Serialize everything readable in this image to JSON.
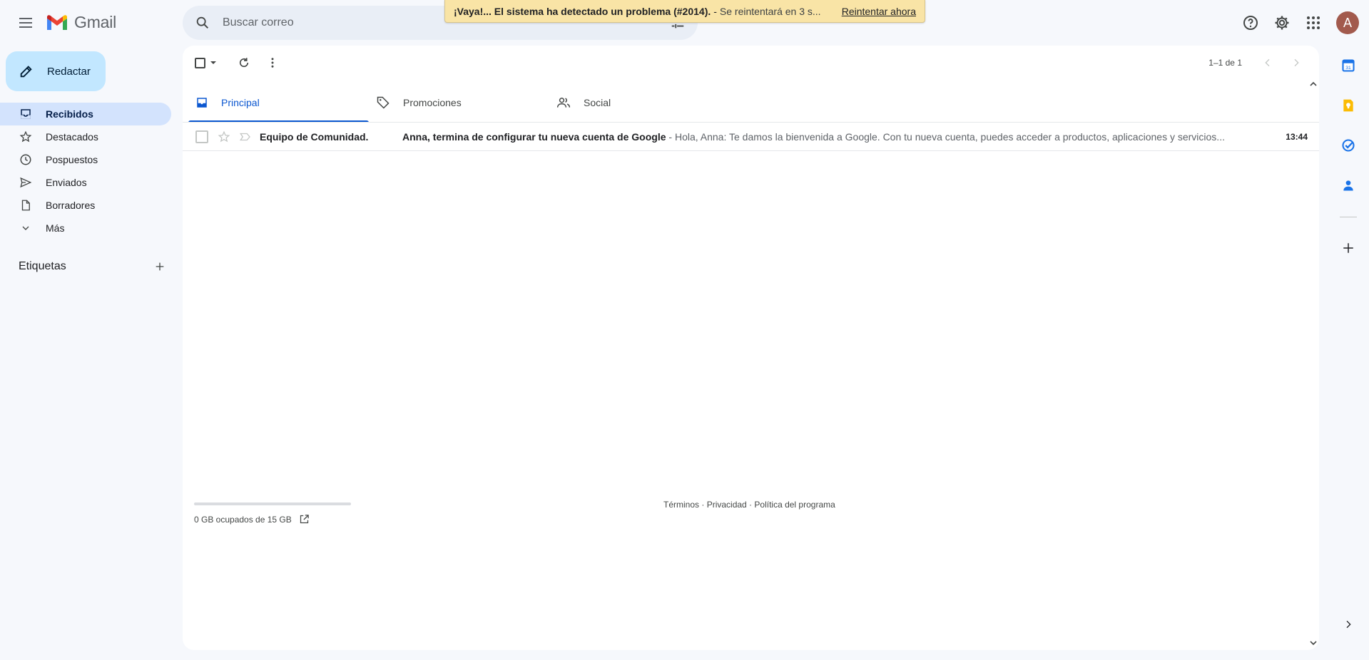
{
  "topbar": {
    "logo_text": "Gmail",
    "search_placeholder": "Buscar correo",
    "avatar_letter": "A"
  },
  "toast": {
    "title": "¡Vaya!... El sistema ha detectado un problema (#2014).",
    "separator": "-",
    "message": "Se reintentará en 3 s...",
    "action": "Reintentar ahora"
  },
  "compose": {
    "label": "Redactar"
  },
  "nav": {
    "items": [
      {
        "label": "Recibidos",
        "icon": "inbox-icon"
      },
      {
        "label": "Destacados",
        "icon": "star-icon"
      },
      {
        "label": "Pospuestos",
        "icon": "clock-icon"
      },
      {
        "label": "Enviados",
        "icon": "send-icon"
      },
      {
        "label": "Borradores",
        "icon": "draft-icon"
      },
      {
        "label": "Más",
        "icon": "chevron-down-icon"
      }
    ],
    "labels_title": "Etiquetas"
  },
  "toolbar": {
    "pager": "1–1 de 1"
  },
  "tabs": [
    {
      "label": "Principal",
      "active": true
    },
    {
      "label": "Promociones",
      "active": false
    },
    {
      "label": "Social",
      "active": false
    }
  ],
  "emails": [
    {
      "sender": "Equipo de Comunidad.",
      "subject": "Anna, termina de configurar tu nueva cuenta de Google",
      "separator": " - ",
      "snippet": "Hola, Anna: Te damos la bienvenida a Google. Con tu nueva cuenta, puedes acceder a productos, aplicaciones y servicios...",
      "time": "13:44"
    }
  ],
  "storage": {
    "text": "0 GB ocupados de 15 GB",
    "used_fraction": 0
  },
  "footer": {
    "terms": "Términos",
    "dot1": " · ",
    "privacy": "Privacidad",
    "dot2": " · ",
    "policy": "Política del programa"
  },
  "colors": {
    "accent": "#0b57d0",
    "compose_bg": "#c2e7ff",
    "active_nav_bg": "#d3e3fd",
    "toast_bg": "#f9e4a6",
    "avatar_bg": "#a25a4d"
  }
}
